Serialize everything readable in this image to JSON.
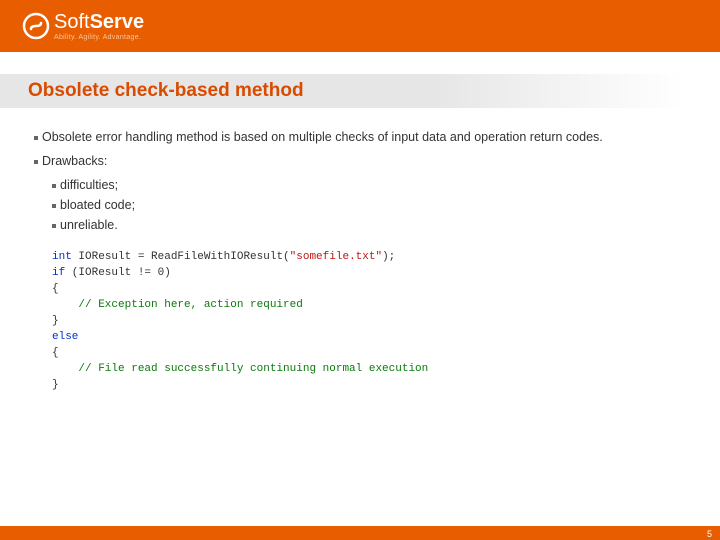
{
  "header": {
    "logo_name": "SoftServe",
    "logo_soft": "Soft",
    "logo_serve": "Serve",
    "tagline": "Ability. Agility. Advantage."
  },
  "title": "Obsolete check-based method",
  "body": {
    "p1": "Obsolete error handling method is based on multiple checks of input data and operation return codes.",
    "p2": "Drawbacks:",
    "sub": {
      "a": "difficulties;",
      "b": "bloated code;",
      "c": "unreliable."
    }
  },
  "code": {
    "kw_int": "int",
    "l1a": " IOResult = ReadFileWithIOResult(",
    "l1s": "\"somefile.txt\"",
    "l1b": ");",
    "kw_if": "if",
    "l2": " (IOResult != 0)",
    "l3": "{",
    "l4c": "    // Exception here, action required",
    "l5": "}",
    "kw_else": "else",
    "l7": "{",
    "l8c": "    // File read successfully continuing normal execution",
    "l9": "}"
  },
  "page_number": "5"
}
